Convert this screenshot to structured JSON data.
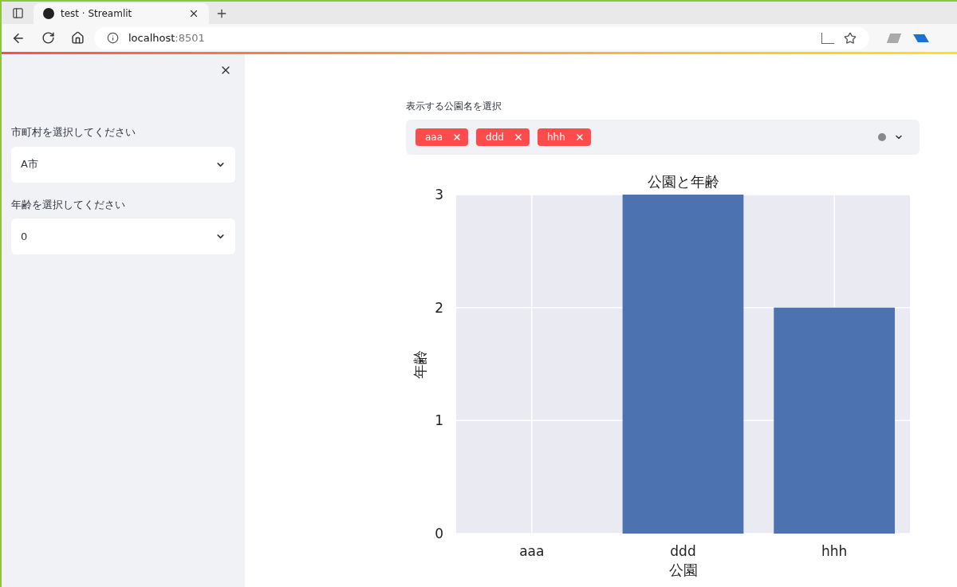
{
  "browser": {
    "tab_title": "test · Streamlit",
    "url_host": "localhost",
    "url_port": ":8501"
  },
  "sidebar": {
    "fields": [
      {
        "label": "市町村を選択してください",
        "value": "A市"
      },
      {
        "label": "年齢を選択してください",
        "value": "0"
      }
    ]
  },
  "multiselect": {
    "label": "表示する公園名を選択",
    "tags": [
      "aaa",
      "ddd",
      "hhh"
    ]
  },
  "chart": {
    "chart_data": {
      "type": "bar",
      "title": "公園と年齢",
      "xlabel": "公園",
      "ylabel": "年齢",
      "categories": [
        "aaa",
        "ddd",
        "hhh"
      ],
      "values": [
        0,
        3,
        2
      ],
      "ylim": [
        0,
        3
      ],
      "yticks": [
        0,
        1,
        2,
        3
      ],
      "grid": true
    }
  }
}
